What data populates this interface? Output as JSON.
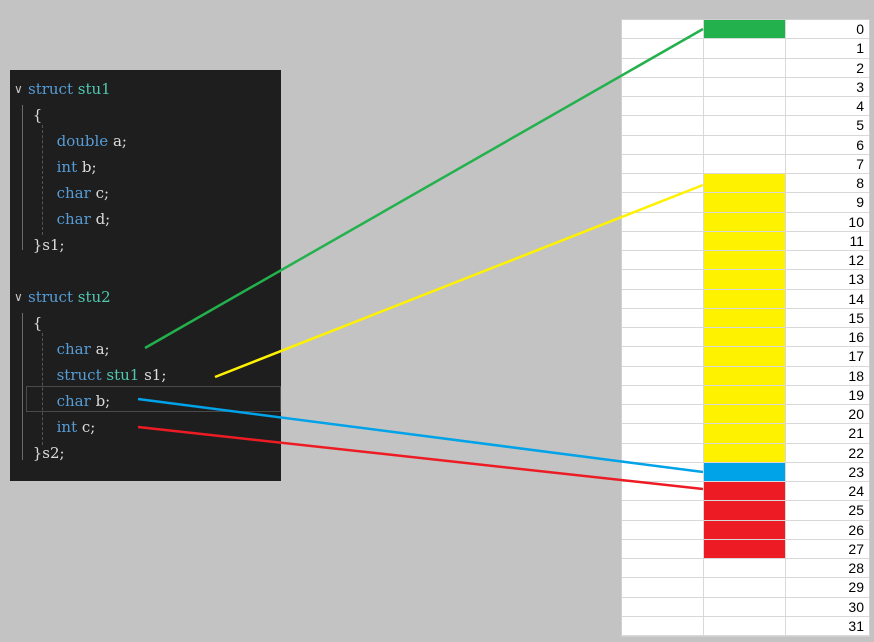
{
  "code": {
    "lines": [
      {
        "fold": "∨",
        "parts": [
          {
            "t": "struct",
            "c": "kw"
          },
          {
            "t": " ",
            "c": "pl"
          },
          {
            "t": "stu1",
            "c": "ty"
          }
        ]
      },
      {
        "fold": "",
        "parts": [
          {
            "t": " {",
            "c": "pl"
          }
        ]
      },
      {
        "fold": "",
        "parts": [
          {
            "t": "      ",
            "c": "pl"
          },
          {
            "t": "double",
            "c": "kw"
          },
          {
            "t": " a;",
            "c": "pl"
          }
        ]
      },
      {
        "fold": "",
        "parts": [
          {
            "t": "      ",
            "c": "pl"
          },
          {
            "t": "int",
            "c": "kw"
          },
          {
            "t": " b;",
            "c": "pl"
          }
        ]
      },
      {
        "fold": "",
        "parts": [
          {
            "t": "      ",
            "c": "pl"
          },
          {
            "t": "char",
            "c": "kw"
          },
          {
            "t": " c;",
            "c": "pl"
          }
        ]
      },
      {
        "fold": "",
        "parts": [
          {
            "t": "      ",
            "c": "pl"
          },
          {
            "t": "char",
            "c": "kw"
          },
          {
            "t": " d;",
            "c": "pl"
          }
        ]
      },
      {
        "fold": "",
        "parts": [
          {
            "t": " }s1;",
            "c": "pl"
          }
        ]
      },
      {
        "fold": "",
        "parts": []
      },
      {
        "fold": "∨",
        "parts": [
          {
            "t": "struct",
            "c": "kw"
          },
          {
            "t": " ",
            "c": "pl"
          },
          {
            "t": "stu2",
            "c": "ty"
          }
        ]
      },
      {
        "fold": "",
        "parts": [
          {
            "t": " {",
            "c": "pl"
          }
        ]
      },
      {
        "fold": "",
        "parts": [
          {
            "t": "      ",
            "c": "pl"
          },
          {
            "t": "char",
            "c": "kw"
          },
          {
            "t": " a;",
            "c": "pl"
          }
        ]
      },
      {
        "fold": "",
        "parts": [
          {
            "t": "      ",
            "c": "pl"
          },
          {
            "t": "struct",
            "c": "kw"
          },
          {
            "t": " ",
            "c": "pl"
          },
          {
            "t": "stu1",
            "c": "ty"
          },
          {
            "t": " s1;",
            "c": "pl"
          }
        ]
      },
      {
        "fold": "",
        "parts": [
          {
            "t": "      ",
            "c": "pl"
          },
          {
            "t": "char",
            "c": "kw"
          },
          {
            "t": " b;",
            "c": "pl"
          }
        ]
      },
      {
        "fold": "",
        "parts": [
          {
            "t": "      ",
            "c": "pl"
          },
          {
            "t": "int",
            "c": "kw"
          },
          {
            "t": " c;",
            "c": "pl"
          }
        ]
      },
      {
        "fold": "",
        "parts": [
          {
            "t": " }s2;",
            "c": "pl"
          }
        ]
      }
    ]
  },
  "memory": {
    "offsets": [
      "0",
      "1",
      "2",
      "3",
      "4",
      "5",
      "6",
      "7",
      "8",
      "9",
      "10",
      "11",
      "12",
      "13",
      "14",
      "15",
      "16",
      "17",
      "18",
      "19",
      "20",
      "21",
      "22",
      "23",
      "24",
      "25",
      "26",
      "27",
      "28",
      "29",
      "30",
      "31"
    ],
    "regions": [
      {
        "member": "char a",
        "start": 0,
        "end": 0,
        "color": "#22b14c"
      },
      {
        "member": "struct stu1 s1",
        "start": 8,
        "end": 23,
        "color": "#fff200"
      },
      {
        "member": "char b",
        "start": 23,
        "end": 23,
        "color": "#00a2e8"
      },
      {
        "member": "int c",
        "start": 24,
        "end": 27,
        "color": "#ed1c24"
      }
    ]
  },
  "colors": {
    "green": "#22b14c",
    "yellow": "#fff200",
    "blue": "#00a2e8",
    "red": "#ed1c24"
  }
}
